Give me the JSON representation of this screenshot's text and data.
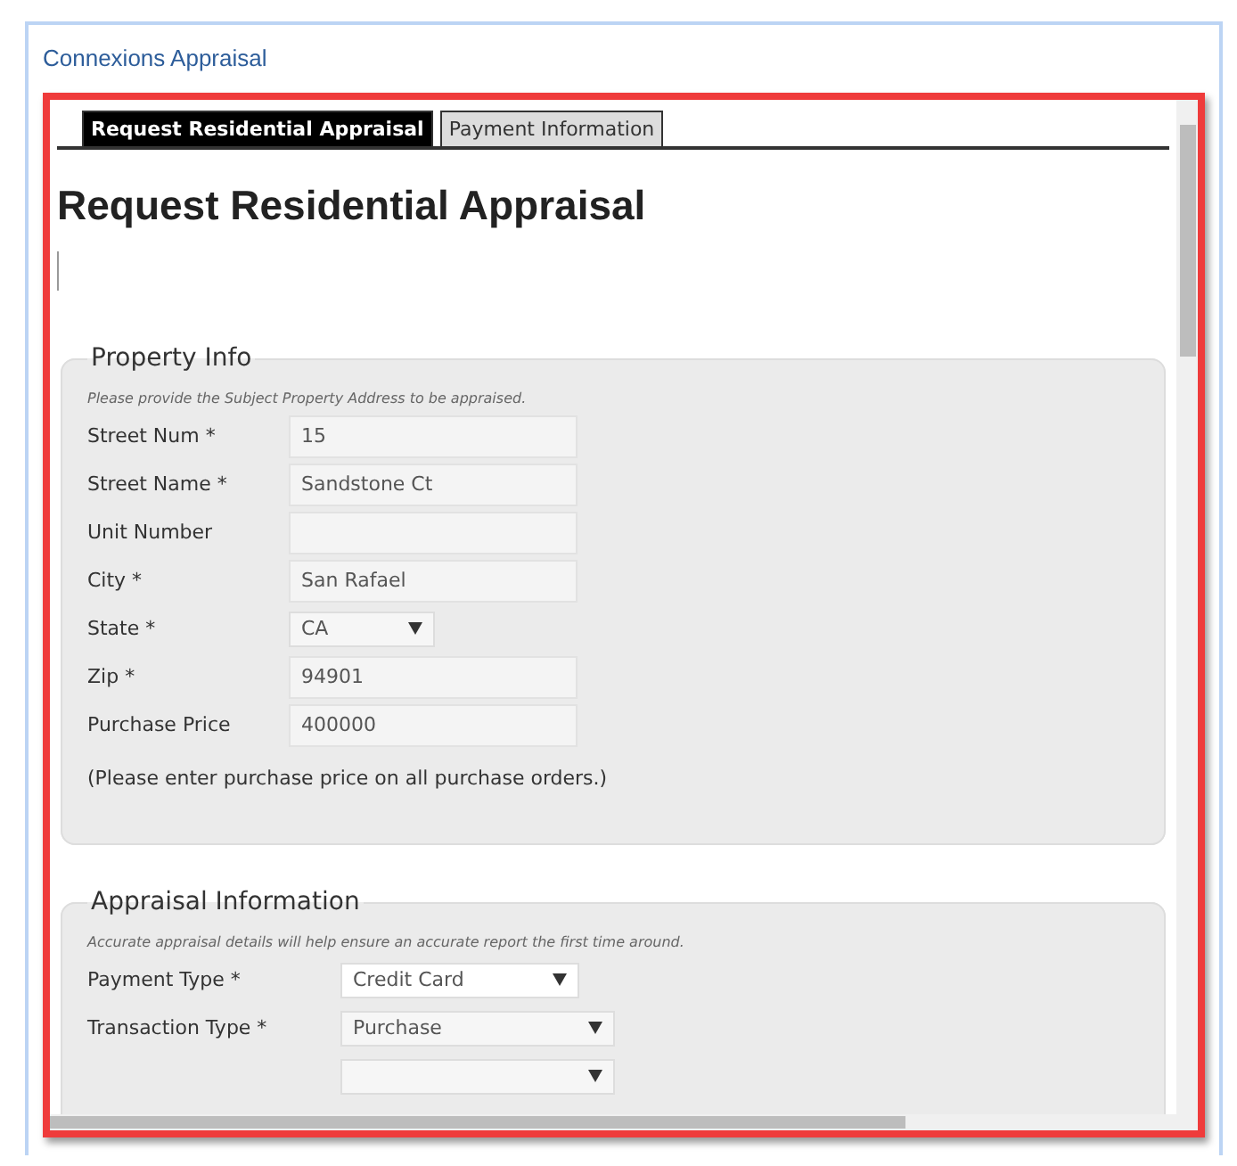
{
  "window": {
    "title": "Connexions Appraisal"
  },
  "tabs": [
    {
      "label": "Request Residential Appraisal",
      "selected": true
    },
    {
      "label": "Payment Information",
      "selected": false
    }
  ],
  "heading": "Request Residential Appraisal",
  "sections": [
    {
      "legend": "Property Info",
      "note": "Please provide the Subject Property Address to be appraised.",
      "fields": [
        {
          "kind": "text",
          "label": "Street Num *",
          "value": "15"
        },
        {
          "kind": "text",
          "label": "Street Name *",
          "value": "Sandstone Ct"
        },
        {
          "kind": "text",
          "label": "Unit Number"
        },
        {
          "kind": "text",
          "label": "City *",
          "value": "San Rafael"
        },
        {
          "kind": "select",
          "label": "State *",
          "value": "CA"
        },
        {
          "kind": "text",
          "label": "Zip *",
          "value": "94901"
        },
        {
          "kind": "text",
          "label": "Purchase Price",
          "value": "400000"
        }
      ],
      "footnote": "(Please enter purchase price on all purchase orders.)"
    },
    {
      "legend": "Appraisal Information",
      "note": "Accurate appraisal details will help ensure an accurate report the first time around.",
      "fields": [
        {
          "kind": "select",
          "label": "Payment Type *",
          "value": "Credit Card"
        },
        {
          "kind": "select",
          "label": "Transaction Type *",
          "value": "Purchase"
        },
        {
          "kind": "select"
        }
      ]
    }
  ]
}
